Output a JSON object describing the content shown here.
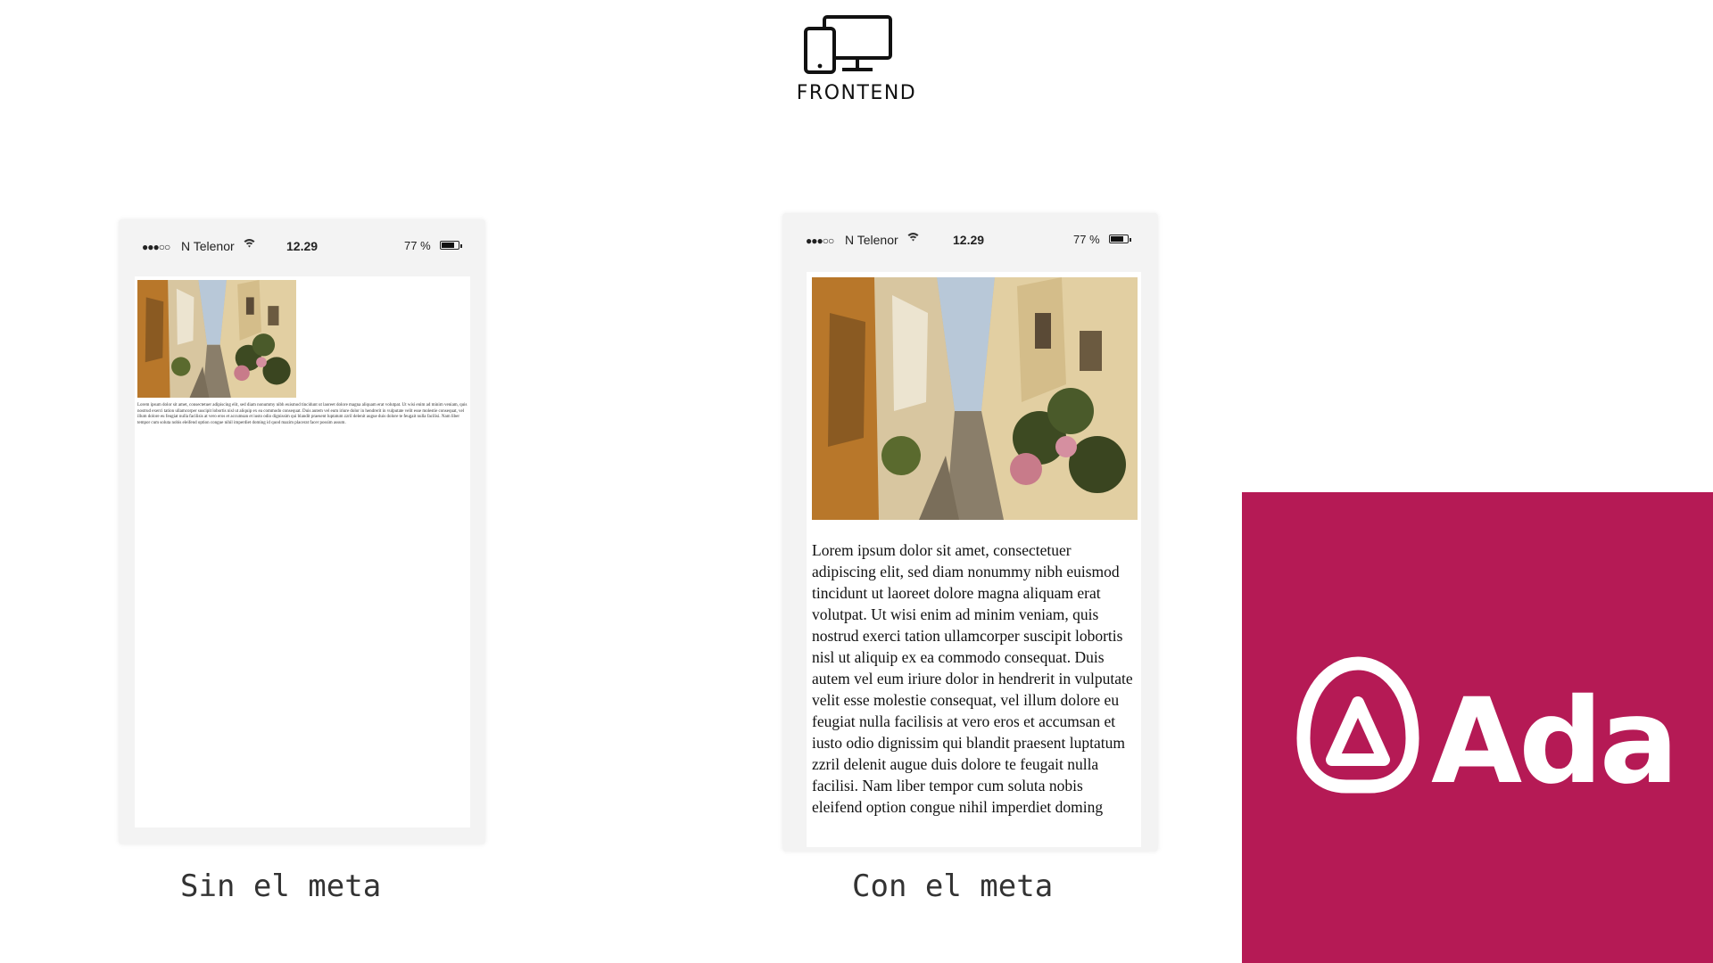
{
  "header": {
    "icon": "devices-icon",
    "title": "FRONTEND"
  },
  "phones": {
    "left": {
      "status": {
        "signal": "●●●○○",
        "carrier": "N Telenor",
        "wifi": "wifi-icon",
        "time": "12.29",
        "battery_pct": "77 %",
        "battery_level": 0.77
      },
      "image": "alley-photo",
      "body_text": "Lorem ipsum dolor sit amet, consectetuer adipiscing elit, sed diam nonummy nibh euismod tincidunt ut laoreet dolore magna aliquam erat volutpat. Ut wisi enim ad minim veniam, quis nostrud exerci tation ullamcorper suscipit lobortis nisl ut aliquip ex ea commodo consequat. Duis autem vel eum iriure dolor in hendrerit in vulputate velit esse molestie consequat, vel illum dolore eu feugiat nulla facilisis at vero eros et accumsan et iusto odio dignissim qui blandit praesent luptatum zzril delenit augue duis dolore te feugait nulla facilisi. Nam liber tempor cum soluta nobis eleifend option congue nihil imperdiet doming id quod mazim placerat facer possim assum.",
      "caption": "Sin el meta"
    },
    "right": {
      "status": {
        "signal": "●●●○○",
        "carrier": "N Telenor",
        "wifi": "wifi-icon",
        "time": "12.29",
        "battery_pct": "77 %",
        "battery_level": 0.77
      },
      "image": "alley-photo",
      "body_text": "Lorem ipsum dolor sit amet, consectetuer adipiscing elit, sed diam nonummy nibh euismod tincidunt ut laoreet dolore magna aliquam erat volutpat. Ut wisi enim ad minim veniam, quis nostrud exerci tation ullamcorper suscipit lobortis nisl ut aliquip ex ea commodo consequat. Duis autem vel eum iriure dolor in hendrerit in vulputate velit esse molestie consequat, vel illum dolore eu feugiat nulla facilisis at vero eros et accumsan et iusto odio dignissim qui blandit praesent luptatum zzril delenit augue duis dolore te feugait nulla facilisi. Nam liber tempor cum soluta nobis eleifend option congue nihil imperdiet doming",
      "caption": "Con el meta"
    }
  },
  "brand": {
    "name": "Ada",
    "icon": "ada-logo-icon",
    "color": "#b51a55"
  }
}
